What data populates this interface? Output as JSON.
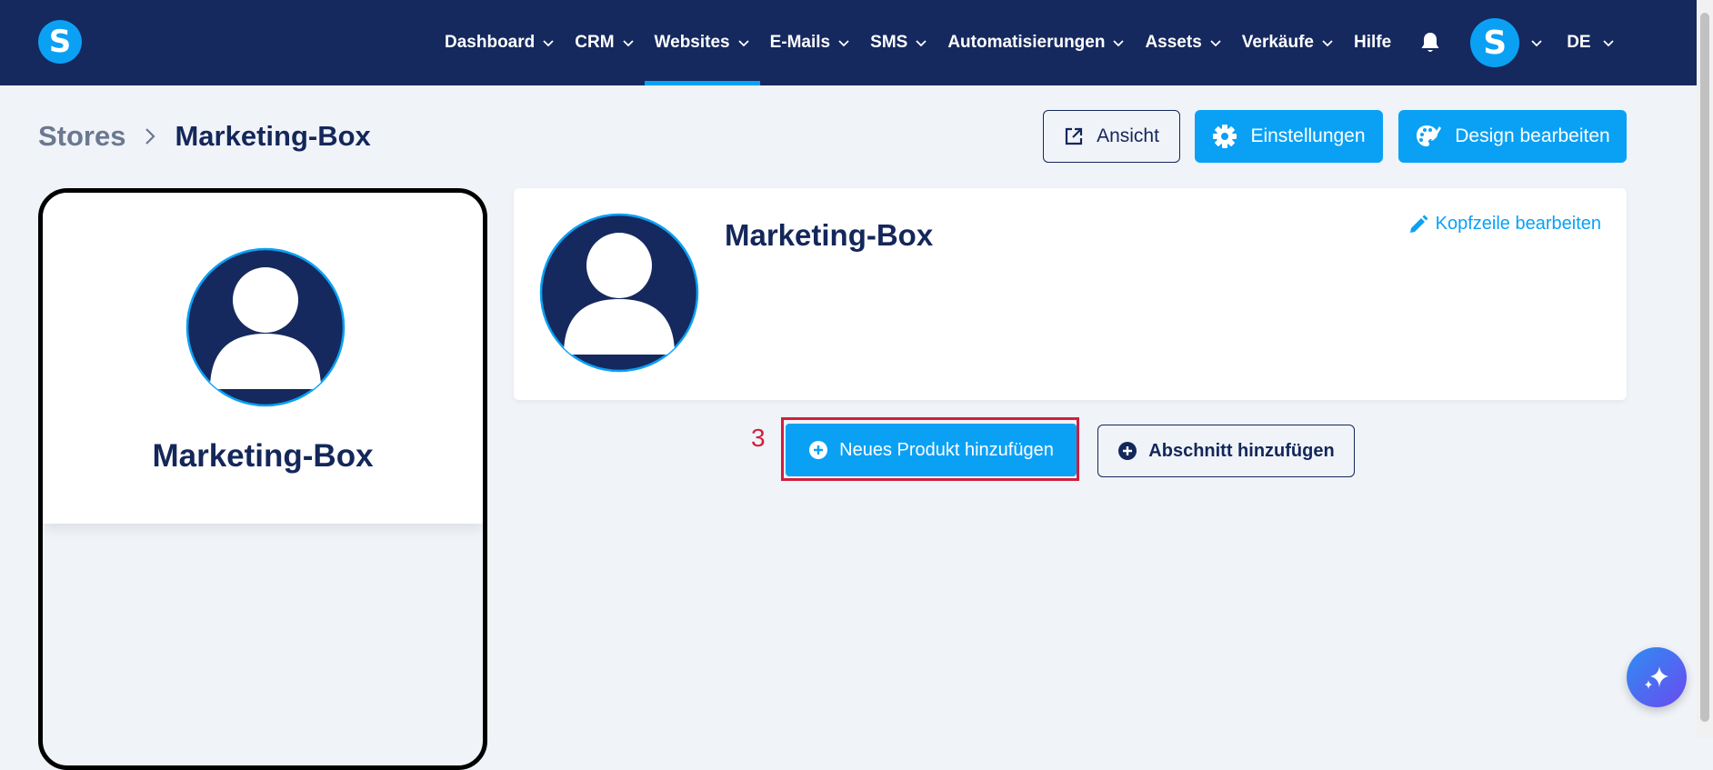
{
  "app": {
    "logo_letter": "S"
  },
  "nav": {
    "items": [
      {
        "label": "Dashboard",
        "has_dropdown": true,
        "active": false
      },
      {
        "label": "CRM",
        "has_dropdown": true,
        "active": false
      },
      {
        "label": "Websites",
        "has_dropdown": true,
        "active": true
      },
      {
        "label": "E-Mails",
        "has_dropdown": true,
        "active": false
      },
      {
        "label": "SMS",
        "has_dropdown": true,
        "active": false
      },
      {
        "label": "Automatisierungen",
        "has_dropdown": true,
        "active": false
      },
      {
        "label": "Assets",
        "has_dropdown": true,
        "active": false
      },
      {
        "label": "Verkäufe",
        "has_dropdown": true,
        "active": false
      },
      {
        "label": "Hilfe",
        "has_dropdown": false,
        "active": false
      }
    ],
    "avatar_letter": "S",
    "language": "DE"
  },
  "breadcrumb": {
    "parent": "Stores",
    "current": "Marketing-Box"
  },
  "header_buttons": {
    "view": "Ansicht",
    "settings": "Einstellungen",
    "design": "Design bearbeiten"
  },
  "preview": {
    "store_name": "Marketing-Box"
  },
  "store_header": {
    "title": "Marketing-Box",
    "edit_label": "Kopfzeile bearbeiten"
  },
  "actions": {
    "step_number": "3",
    "add_product": "Neues Produkt hinzufügen",
    "add_section": "Abschnitt hinzufügen"
  },
  "colors": {
    "navbar": "#15295e",
    "accent": "#0aa1f5",
    "text": "#14275a",
    "highlight": "#d01f3c",
    "background": "#f0f3f8"
  },
  "icons": {
    "notification": "bell-icon",
    "view": "external-link-icon",
    "settings": "gear-icon",
    "design": "palette-icon",
    "edit": "pencil-icon",
    "add": "plus-circle-icon",
    "assistant": "sparkle-icon"
  }
}
